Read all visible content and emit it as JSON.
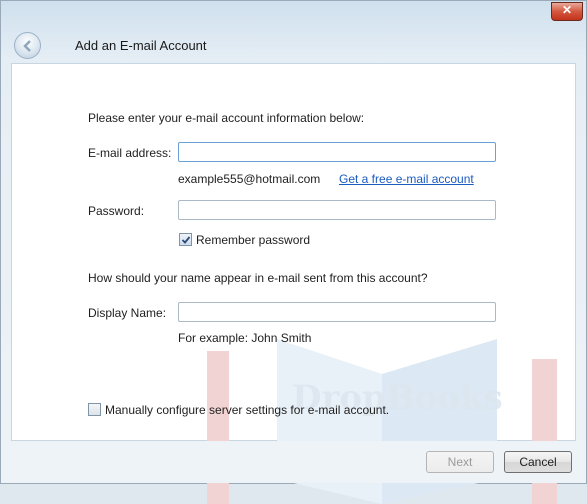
{
  "window": {
    "title": "Add an E-mail Account",
    "close_glyph": "✕"
  },
  "form": {
    "instruction": "Please enter your e-mail account information below:",
    "email_label": "E-mail address:",
    "email_value": "",
    "email_example": "example555@hotmail.com",
    "free_account_link": "Get a free e-mail account",
    "password_label": "Password:",
    "password_value": "",
    "remember_label": "Remember password",
    "remember_checked": true,
    "name_question": "How should your name appear in e-mail sent from this account?",
    "display_name_label": "Display Name:",
    "display_name_value": "",
    "display_name_example": "For example: John Smith",
    "manual_config_label": "Manually configure server settings for e-mail account.",
    "manual_config_checked": false
  },
  "watermark": {
    "text": "DropBooks"
  },
  "footer": {
    "next_label": "Next",
    "cancel_label": "Cancel"
  }
}
